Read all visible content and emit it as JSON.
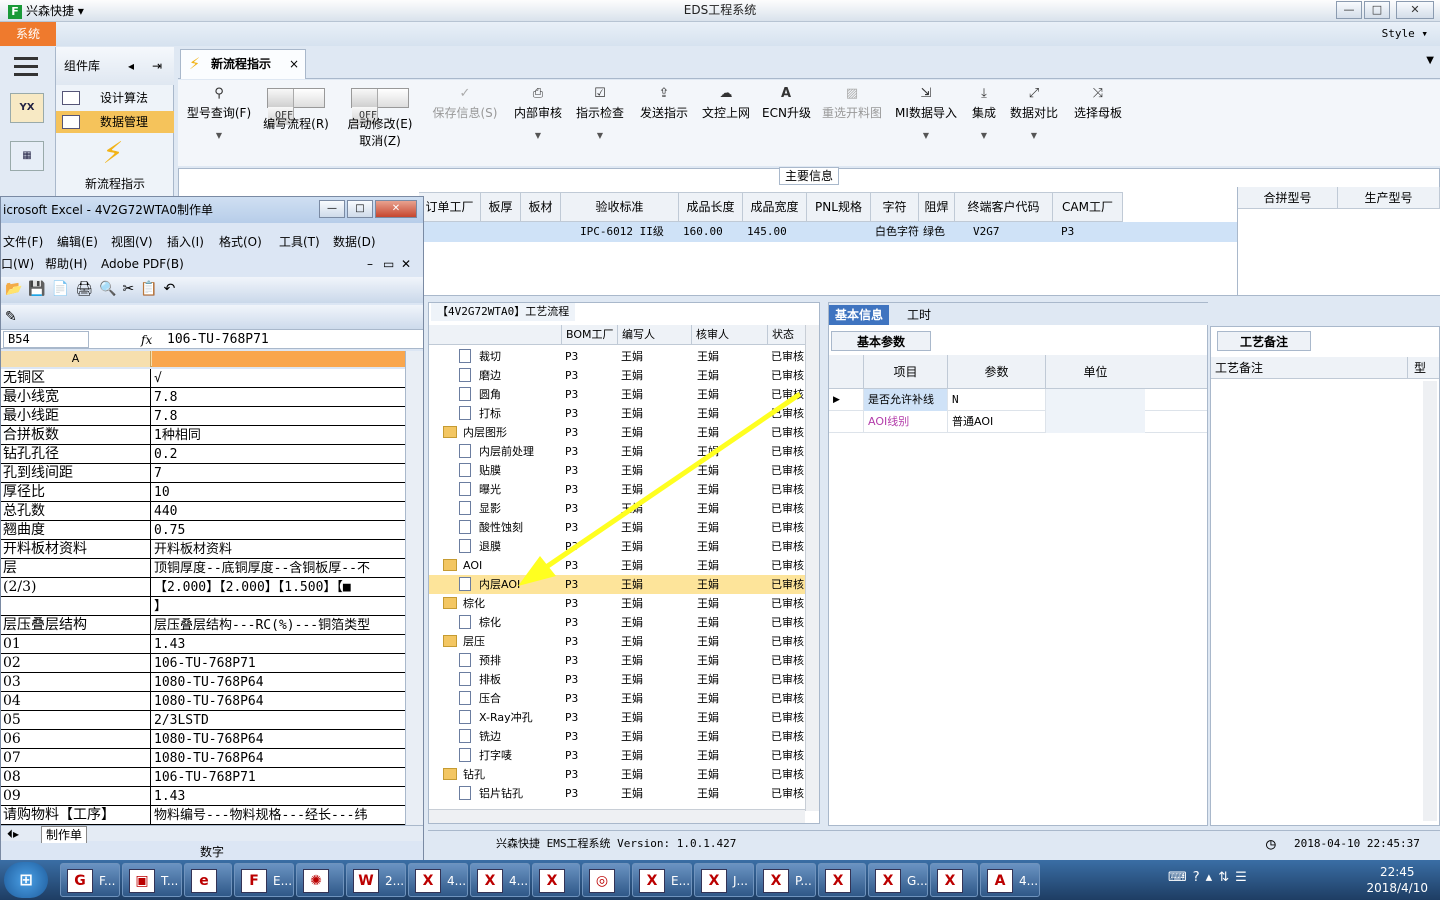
{
  "window": {
    "title": "EDS工程系统",
    "app_name": "兴森快捷",
    "minimize": "—",
    "maximize": "□",
    "close": "✕"
  },
  "menu": {
    "system": "系统",
    "style": "Style"
  },
  "sidebar": {
    "component_lib": "组件库",
    "items": [
      {
        "label": "设计算法"
      },
      {
        "label": "数据管理"
      }
    ],
    "new_flow": "新流程指示",
    "icon_label": "YX"
  },
  "doc_tab": {
    "label": "新流程指示",
    "close": "×"
  },
  "toolbar": {
    "buttons": [
      {
        "label": "型号查询(F)",
        "icon": "search-icon"
      },
      {
        "label": "编写流程(R)",
        "icon": "toggle"
      },
      {
        "label": "启动修改(E)",
        "label2": "取消(Z)",
        "icon": "toggle"
      },
      {
        "label": "保存信息(S)",
        "icon": "check-icon"
      },
      {
        "label": "内部审核",
        "icon": "print-icon"
      },
      {
        "label": "指示检查",
        "icon": "check-icon"
      },
      {
        "label": "发送指示",
        "icon": "upload-icon"
      },
      {
        "label": "文控上网",
        "icon": "cloud-upload-icon"
      },
      {
        "label": "ECN升级",
        "icon": "a-icon"
      },
      {
        "label": "重选开料图",
        "icon": "image-icon"
      },
      {
        "label": "MI数据导入",
        "icon": "import-icon"
      },
      {
        "label": "集成",
        "icon": "download-icon"
      },
      {
        "label": "数据对比",
        "icon": "compare-icon"
      },
      {
        "label": "选择母板",
        "icon": "shuffle-icon"
      }
    ],
    "toggle_off": "OFF"
  },
  "main_info": {
    "title": "主要信息",
    "columns": [
      "订单工厂",
      "板厚",
      "板材",
      "验收标准",
      "成品长度",
      "成品宽度",
      "PNL规格",
      "字符",
      "阻焊",
      "终端客户代码",
      "CAM工厂"
    ],
    "row": [
      "",
      "",
      "",
      "IPC-6012 II级",
      "160.00",
      "145.00",
      "",
      "白色字符",
      "绿色",
      "V2G7",
      "P3"
    ],
    "right_columns": [
      "合拼型号",
      "生产型号"
    ]
  },
  "process": {
    "tab": "【4V2G72WTA0】工艺流程",
    "columns": [
      "BOM工厂",
      "编写人",
      "核审人",
      "状态"
    ],
    "rows": [
      {
        "name": "裁切",
        "type": "doc",
        "level": 2,
        "bom": "P3",
        "writer": "王娟",
        "reviewer": "王娟",
        "status": "已审核"
      },
      {
        "name": "磨边",
        "type": "doc",
        "level": 2,
        "bom": "P3",
        "writer": "王娟",
        "reviewer": "王娟",
        "status": "已审核"
      },
      {
        "name": "圆角",
        "type": "doc",
        "level": 2,
        "bom": "P3",
        "writer": "王娟",
        "reviewer": "王娟",
        "status": "已审核"
      },
      {
        "name": "打标",
        "type": "doc",
        "level": 2,
        "bom": "P3",
        "writer": "王娟",
        "reviewer": "王娟",
        "status": "已审核"
      },
      {
        "name": "内层图形",
        "type": "folder",
        "level": 1,
        "bom": "P3",
        "writer": "王娟",
        "reviewer": "王娟",
        "status": "已审核"
      },
      {
        "name": "内层前处理",
        "type": "doc",
        "level": 2,
        "bom": "P3",
        "writer": "王娟",
        "reviewer": "王娟",
        "status": "已审核"
      },
      {
        "name": "贴膜",
        "type": "doc",
        "level": 2,
        "bom": "P3",
        "writer": "王娟",
        "reviewer": "王娟",
        "status": "已审核"
      },
      {
        "name": "曝光",
        "type": "doc",
        "level": 2,
        "bom": "P3",
        "writer": "王娟",
        "reviewer": "王娟",
        "status": "已审核"
      },
      {
        "name": "显影",
        "type": "doc",
        "level": 2,
        "bom": "P3",
        "writer": "王娟",
        "reviewer": "王娟",
        "status": "已审核"
      },
      {
        "name": "酸性蚀刻",
        "type": "doc",
        "level": 2,
        "bom": "P3",
        "writer": "王娟",
        "reviewer": "王娟",
        "status": "已审核"
      },
      {
        "name": "退膜",
        "type": "doc",
        "level": 2,
        "bom": "P3",
        "writer": "王娟",
        "reviewer": "王娟",
        "status": "已审核"
      },
      {
        "name": "AOI",
        "type": "folder",
        "level": 1,
        "bom": "P3",
        "writer": "王娟",
        "reviewer": "王娟",
        "status": "已审核"
      },
      {
        "name": "内层AOI",
        "type": "doc",
        "level": 2,
        "bom": "P3",
        "writer": "王娟",
        "reviewer": "王娟",
        "status": "已审核",
        "selected": true
      },
      {
        "name": "棕化",
        "type": "folder",
        "level": 1,
        "bom": "P3",
        "writer": "王娟",
        "reviewer": "王娟",
        "status": "已审核"
      },
      {
        "name": "棕化",
        "type": "doc",
        "level": 2,
        "bom": "P3",
        "writer": "王娟",
        "reviewer": "王娟",
        "status": "已审核"
      },
      {
        "name": "层压",
        "type": "folder",
        "level": 1,
        "bom": "P3",
        "writer": "王娟",
        "reviewer": "王娟",
        "status": "已审核"
      },
      {
        "name": "预排",
        "type": "doc",
        "level": 2,
        "bom": "P3",
        "writer": "王娟",
        "reviewer": "王娟",
        "status": "已审核"
      },
      {
        "name": "排板",
        "type": "doc",
        "level": 2,
        "bom": "P3",
        "writer": "王娟",
        "reviewer": "王娟",
        "status": "已审核"
      },
      {
        "name": "压合",
        "type": "doc",
        "level": 2,
        "bom": "P3",
        "writer": "王娟",
        "reviewer": "王娟",
        "status": "已审核"
      },
      {
        "name": "X-Ray冲孔",
        "type": "doc",
        "level": 2,
        "bom": "P3",
        "writer": "王娟",
        "reviewer": "王娟",
        "status": "已审核"
      },
      {
        "name": "铣边",
        "type": "doc",
        "level": 2,
        "bom": "P3",
        "writer": "王娟",
        "reviewer": "王娟",
        "status": "已审核"
      },
      {
        "name": "打字唛",
        "type": "doc",
        "level": 2,
        "bom": "P3",
        "writer": "王娟",
        "reviewer": "王娟",
        "status": "已审核"
      },
      {
        "name": "钻孔",
        "type": "folder",
        "level": 1,
        "bom": "P3",
        "writer": "王娟",
        "reviewer": "王娟",
        "status": "已审核"
      },
      {
        "name": "铝片钻孔",
        "type": "doc",
        "level": 2,
        "bom": "P3",
        "writer": "王娟",
        "reviewer": "王娟",
        "status": "已审核"
      }
    ]
  },
  "basic_info": {
    "tabs": [
      "基本信息",
      "工时"
    ],
    "sub_tab": "基本参数",
    "columns": [
      "项目",
      "参数",
      "单位"
    ],
    "rows": [
      {
        "item": "是否允许补线",
        "param": "N",
        "unit": ""
      },
      {
        "item": "AOI线别",
        "param": "普通AOI",
        "unit": ""
      }
    ]
  },
  "remarks": {
    "tab": "工艺备注",
    "column": "工艺备注",
    "column2": "型"
  },
  "status_bar": {
    "text": "兴森快捷 EMS工程系统 Version: 1.0.1.427",
    "datetime": "2018-04-10 22:45:37"
  },
  "excel": {
    "title": "icrosoft Excel - 4V2G72WTA0制作单",
    "menu1": [
      "文件(F)",
      "编辑(E)",
      "视图(V)",
      "插入(I)",
      "格式(O)",
      "工具(T)",
      "数据(D)"
    ],
    "menu2": [
      "口(W)",
      "帮助(H)",
      "Adobe PDF(B)"
    ],
    "cell_ref": "B54",
    "fx": "fx",
    "formula": "106-TU-768P71",
    "col_a": "A",
    "rows": [
      [
        "无铜区",
        "√"
      ],
      [
        "最小线宽",
        "7.8"
      ],
      [
        "最小线距",
        "7.8"
      ],
      [
        "合拼板数",
        "1种相同"
      ],
      [
        "钻孔孔径",
        "0.2"
      ],
      [
        "孔到线间距",
        "7"
      ],
      [
        "厚径比",
        "10"
      ],
      [
        "总孔数",
        "440"
      ],
      [
        "翘曲度",
        "0.75"
      ],
      [
        "开料板材资料",
        "开料板材资料"
      ],
      [
        "层",
        "顶铜厚度--底铜厚度--含铜板厚--不"
      ],
      [
        "(2/3)",
        "【2.000】【2.000】【1.500】【■"
      ],
      [
        "",
        "】"
      ],
      [
        "层压叠层结构",
        "层压叠层结构---RC(%)---铜箔类型"
      ],
      [
        "01",
        "1.43"
      ],
      [
        "02",
        "106-TU-768P71"
      ],
      [
        "03",
        "1080-TU-768P64"
      ],
      [
        "04",
        "1080-TU-768P64"
      ],
      [
        "05",
        "2/3LSTD"
      ],
      [
        "06",
        "1080-TU-768P64"
      ],
      [
        "07",
        "1080-TU-768P64"
      ],
      [
        "08",
        "106-TU-768P71"
      ],
      [
        "09",
        "1.43"
      ],
      [
        "请购物料【工序】",
        "物料编号---物料规格---经长---纬"
      ]
    ],
    "sheet_tab": "制作单",
    "status": "数字"
  },
  "taskbar": {
    "items": [
      "F...",
      "T...",
      "",
      "E...",
      "",
      "2...",
      "4...",
      "4...",
      "",
      "",
      "E...",
      "J...",
      "P...",
      "",
      "G...",
      "",
      "4..."
    ],
    "time": "22:45",
    "date": "2018/4/10"
  }
}
